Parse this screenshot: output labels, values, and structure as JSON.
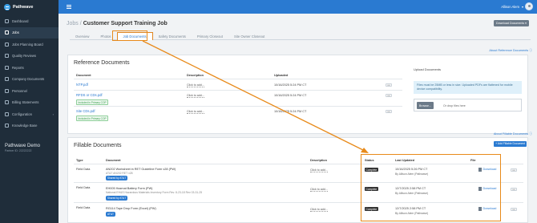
{
  "brand": {
    "name": "Pathwave"
  },
  "sidebar": {
    "items": [
      {
        "label": "Dashboard",
        "icon": "dashboard-icon",
        "active": false
      },
      {
        "label": "Jobs",
        "icon": "jobs-icon",
        "active": true
      },
      {
        "label": "Jobs Planning Board",
        "icon": "board-icon",
        "active": false
      },
      {
        "label": "Quality Reviews",
        "icon": "quality-icon",
        "active": false
      },
      {
        "label": "Reports",
        "icon": "reports-icon",
        "active": false
      },
      {
        "label": "Company Documents",
        "icon": "documents-icon",
        "active": false
      },
      {
        "label": "Personnel",
        "icon": "personnel-icon",
        "active": false
      },
      {
        "label": "Billing Statements",
        "icon": "billing-icon",
        "active": false
      },
      {
        "label": "Configuration",
        "icon": "gear-icon",
        "active": false,
        "chevron": "›"
      },
      {
        "label": "Knowledge Base",
        "icon": "knowledge-icon",
        "active": false
      }
    ],
    "company": "Pathwave Demo",
    "partner_id": "Partner ID: 22222222"
  },
  "topbar": {
    "user": "Allison Alem",
    "chevron": "▾"
  },
  "breadcrumb": {
    "parent": "Jobs",
    "separator": "/",
    "current": "Customer Support Training Job"
  },
  "download_button": "Download Documents ▾",
  "tabs": [
    "Overview",
    "Photos",
    "Job Documents",
    "Safety Documents",
    "Primary Closeout",
    "Site Owner Closeout"
  ],
  "active_tab": "Job Documents",
  "reference": {
    "about_link": "About Reference Documents ⓘ",
    "title": "Reference Documents",
    "headers": {
      "document": "Document",
      "description": "Description",
      "uploaded": "Uploaded"
    },
    "rows": [
      {
        "name": "NTP.pdf",
        "badge": "",
        "description": "Click to add...",
        "uploaded": "10/16/2025 5:24 PM CT"
      },
      {
        "name": "RFDS or CDs.pdf",
        "badge": "Included in Primary COP",
        "description": "Click to add...",
        "uploaded": "10/16/2025 5:24 PM CT"
      },
      {
        "name": "Site CDs.pdf",
        "badge": "Included in Primary COP",
        "description": "Click to add...",
        "uploaded": "10/16/2025 5:24 PM CT"
      }
    ],
    "row_menu": "•••",
    "upload": {
      "title": "Upload Documents",
      "info": "Files must be 25MB or less in size. Uploaded PDFs are flattened for mobile device compatibility.",
      "browse": "Browse...",
      "drop": "Or drop files here"
    }
  },
  "fillable": {
    "about_link": "About Fillable Documents ⓘ",
    "title": "Fillable Documents",
    "add_button": "+ Add Fillable Document",
    "headers": {
      "type": "Type",
      "document": "Document",
      "description": "Description",
      "status": "Status",
      "last_updated": "Last Updated",
      "file": "File"
    },
    "rows": [
      {
        "type": "Field Data",
        "name": "AN202 Worksheet in RET Guideline Form v28 (PW)",
        "subtitle": "AT&T AN202 RET v28",
        "shared": "Shared by AT&T",
        "description": "Click to add...",
        "status": "Complete",
        "updated": "10/16/2025 5:26 PM CT",
        "by": "By Allison Alem (Pathwave)",
        "file": "Download"
      },
      {
        "type": "Field Data",
        "name": "EH005 Hazmat Battery Form (PW)",
        "subtitle": "National EH&S Hazardous Materials Inventory Form Rev. 8-23-18 Rev 03-31-25",
        "shared": "Shared by AT&T",
        "description": "Click to add...",
        "status": "Complete",
        "updated": "12/7/2025 2:58 PM CT",
        "by": "By Allison Alem (Pathwave)",
        "file": "Download"
      },
      {
        "type": "Field Data",
        "name": "RG114 Tape Drop Form (Excel) (PW)",
        "subtitle": "",
        "shared": "AT&T",
        "description": "Click to add...",
        "status": "Complete",
        "updated": "12/7/2025 2:58 PM CT",
        "by": "By Allison Alem (Pathwave)",
        "file": "Download"
      }
    ],
    "row_menu": "•••"
  },
  "colors": {
    "accent": "#2a7ad1",
    "sidebar": "#1f2d3a",
    "highlight": "#e88a1a"
  }
}
